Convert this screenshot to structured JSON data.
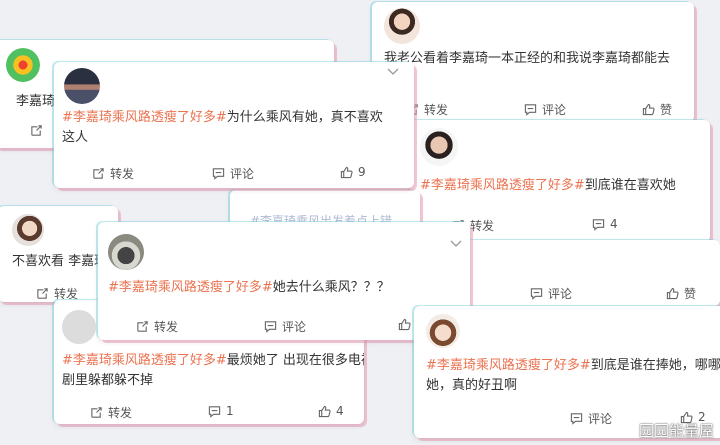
{
  "actions": {
    "repost": "转发",
    "comment": "评论",
    "like": "赞"
  },
  "posts": [
    {
      "text": "李嘉琦"
    },
    {
      "text": "我老公看着李嘉琦一本正经的和我说李嘉琦都能去",
      "line2": "？",
      "repost": "转发",
      "comment": "评论",
      "like": "赞"
    },
    {
      "tag": "#李嘉琦乘风路透瘦了好多#",
      "text": "为什么乘风有她，真不喜欢",
      "line2": "这人",
      "repost": "转发",
      "comment": "评论",
      "like": "9"
    },
    {
      "tag": "#李嘉琦乘风路透瘦了好多#",
      "text": "到底谁在喜欢她",
      "repost": "转发",
      "comment": "4"
    },
    {
      "text": "不喜欢看 李嘉琦",
      "repost": "转发"
    },
    {
      "tag": "#李嘉琦乘风路透瘦了好多#",
      "text": "她去什么乘风？？？",
      "repost": "转发",
      "comment": "评论"
    },
    {
      "tag": "#李嘉琦乘风路透瘦了好多#",
      "text": "最烦她了 出现在很多电视",
      "line2": "剧里躲都躲不掉",
      "repost": "转发",
      "comment": "1",
      "like": "4"
    },
    {
      "tag": "#李嘉琦乘风路透瘦了好多#",
      "text": "到底是谁在捧她，哪哪",
      "line2": "她，真的好丑啊",
      "comment": "评论",
      "like": "2"
    },
    {
      "comment": "评论",
      "like": "赞"
    }
  ],
  "background_snippets": [
    "#李嘉琦乘风出发着点上错"
  ],
  "watermark": "园园能量屋"
}
